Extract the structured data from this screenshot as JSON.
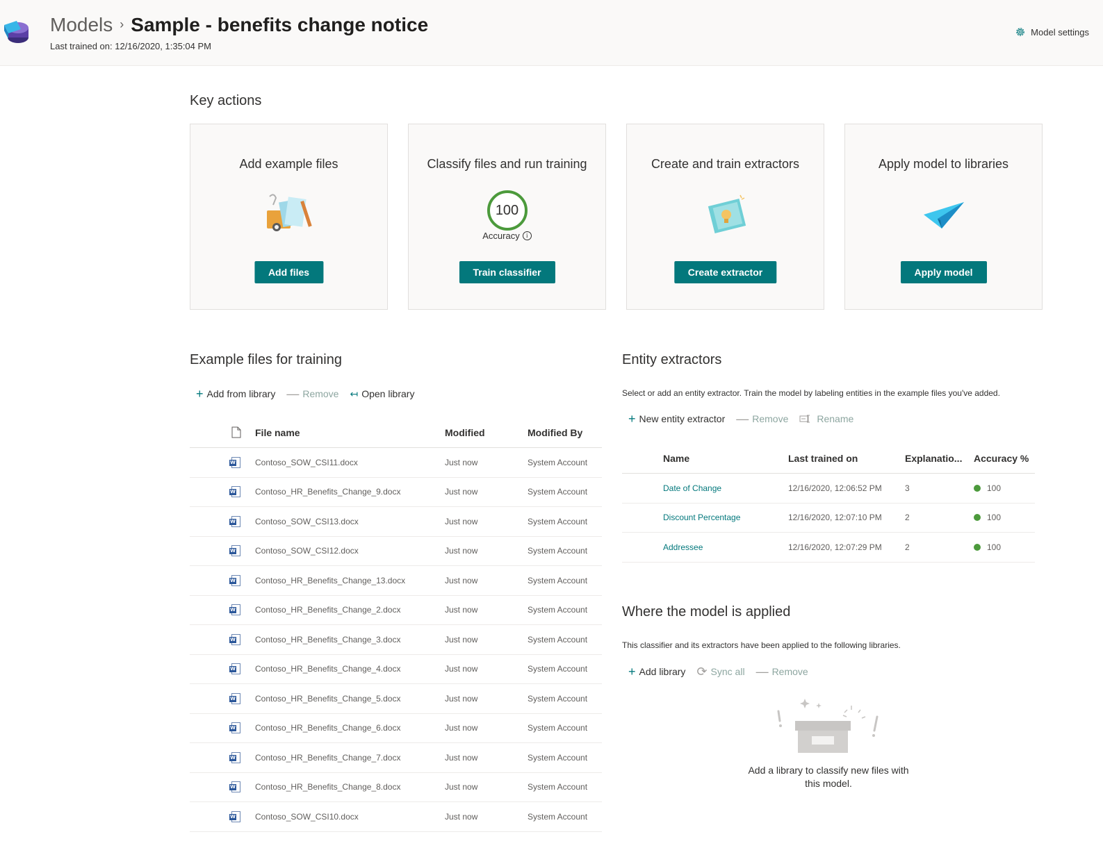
{
  "header": {
    "breadcrumb_root": "Models",
    "breadcrumb_sep": "›",
    "title": "Sample - benefits change notice",
    "last_trained": "Last trained on: 12/16/2020, 1:35:04 PM",
    "settings_label": "Model settings"
  },
  "key_actions": {
    "title": "Key actions",
    "cards": [
      {
        "title": "Add example files",
        "button": "Add files"
      },
      {
        "title": "Classify files and run training",
        "button": "Train classifier",
        "accuracy_value": "100",
        "accuracy_label": "Accuracy",
        "info_glyph": "i"
      },
      {
        "title": "Create and train extractors",
        "button": "Create extractor"
      },
      {
        "title": "Apply model to libraries",
        "button": "Apply model"
      }
    ]
  },
  "files": {
    "title": "Example files for training",
    "commands": {
      "add": "Add from library",
      "remove": "Remove",
      "open": "Open library"
    },
    "columns": {
      "name": "File name",
      "modified": "Modified",
      "modified_by": "Modified By"
    },
    "rows": [
      {
        "name": "Contoso_SOW_CSI11.docx",
        "modified": "Just now",
        "by": "System Account"
      },
      {
        "name": "Contoso_HR_Benefits_Change_9.docx",
        "modified": "Just now",
        "by": "System Account"
      },
      {
        "name": "Contoso_SOW_CSI13.docx",
        "modified": "Just now",
        "by": "System Account"
      },
      {
        "name": "Contoso_SOW_CSI12.docx",
        "modified": "Just now",
        "by": "System Account"
      },
      {
        "name": "Contoso_HR_Benefits_Change_13.docx",
        "modified": "Just now",
        "by": "System Account"
      },
      {
        "name": "Contoso_HR_Benefits_Change_2.docx",
        "modified": "Just now",
        "by": "System Account"
      },
      {
        "name": "Contoso_HR_Benefits_Change_3.docx",
        "modified": "Just now",
        "by": "System Account"
      },
      {
        "name": "Contoso_HR_Benefits_Change_4.docx",
        "modified": "Just now",
        "by": "System Account"
      },
      {
        "name": "Contoso_HR_Benefits_Change_5.docx",
        "modified": "Just now",
        "by": "System Account"
      },
      {
        "name": "Contoso_HR_Benefits_Change_6.docx",
        "modified": "Just now",
        "by": "System Account"
      },
      {
        "name": "Contoso_HR_Benefits_Change_7.docx",
        "modified": "Just now",
        "by": "System Account"
      },
      {
        "name": "Contoso_HR_Benefits_Change_8.docx",
        "modified": "Just now",
        "by": "System Account"
      },
      {
        "name": "Contoso_SOW_CSI10.docx",
        "modified": "Just now",
        "by": "System Account"
      }
    ]
  },
  "extractors": {
    "title": "Entity extractors",
    "description": "Select or add an entity extractor. Train the model by labeling entities in the example files you've added.",
    "commands": {
      "add": "New entity extractor",
      "remove": "Remove",
      "rename": "Rename"
    },
    "columns": {
      "name": "Name",
      "last_trained": "Last trained on",
      "explanations": "Explanatio...",
      "accuracy": "Accuracy %"
    },
    "rows": [
      {
        "name": "Date of Change",
        "last_trained": "12/16/2020, 12:06:52 PM",
        "explanations": "3",
        "accuracy": "100"
      },
      {
        "name": "Discount Percentage",
        "last_trained": "12/16/2020, 12:07:10 PM",
        "explanations": "2",
        "accuracy": "100"
      },
      {
        "name": "Addressee",
        "last_trained": "12/16/2020, 12:07:29 PM",
        "explanations": "2",
        "accuracy": "100"
      }
    ],
    "status_color": "#4c9a3c"
  },
  "applied": {
    "title": "Where the model is applied",
    "description": "This classifier and its extractors have been applied to the following libraries.",
    "commands": {
      "add": "Add library",
      "sync": "Sync all",
      "remove": "Remove"
    },
    "empty_text": "Add a library to classify new files with this model."
  },
  "theme": {
    "accent": "#03787c",
    "success": "#4c9a3c",
    "word_blue": "#2b579a"
  }
}
